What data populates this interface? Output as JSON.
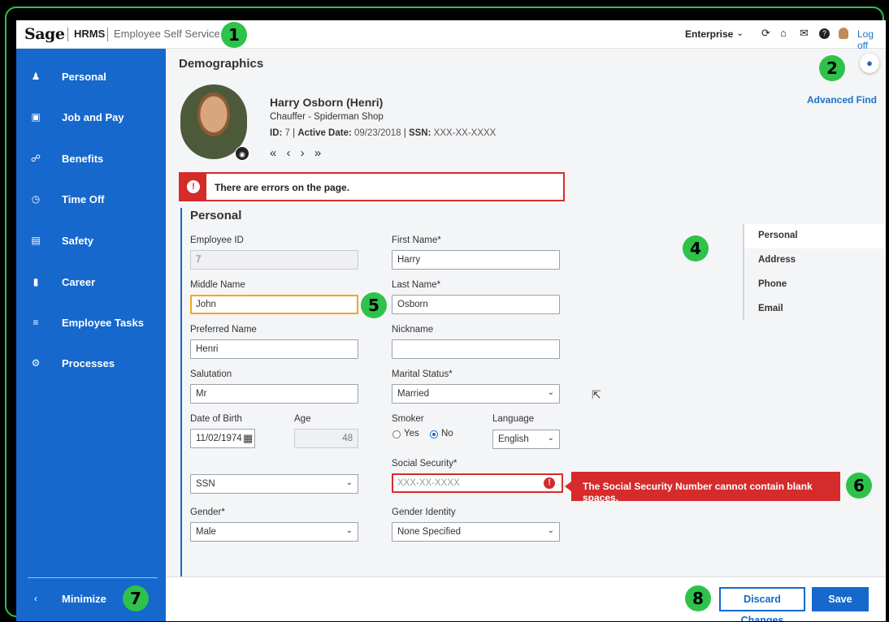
{
  "colors": {
    "primary": "#1668cc",
    "error": "#d52b2b",
    "callout": "#2ec24a",
    "focus": "#f0a81e"
  },
  "topbar": {
    "logo": "Sage",
    "app_name": "HRMS",
    "module": "Employee Self Service",
    "company": "Enterprise",
    "icons": [
      "chevron-down-icon",
      "refresh-icon",
      "home-icon",
      "mail-icon",
      "help-icon",
      "user-avatar-icon"
    ],
    "logoff": "Log off"
  },
  "sidebar": {
    "items": [
      {
        "label": "Personal",
        "icon": "person-icon"
      },
      {
        "label": "Job and Pay",
        "icon": "briefcase-icon"
      },
      {
        "label": "Benefits",
        "icon": "benefits-icon"
      },
      {
        "label": "Time Off",
        "icon": "clock-icon"
      },
      {
        "label": "Safety",
        "icon": "safety-icon"
      },
      {
        "label": "Career",
        "icon": "career-icon"
      },
      {
        "label": "Employee Tasks",
        "icon": "tasks-icon"
      },
      {
        "label": "Processes",
        "icon": "gear-icon"
      }
    ],
    "minimize": "Minimize"
  },
  "main": {
    "title": "Demographics",
    "advanced_find": "Advanced Find",
    "employee": {
      "name": "Harry Osborn (Henri)",
      "job": "Chauffer - Spiderman Shop",
      "id_label": "ID:",
      "id": "7",
      "active_label": "Active Date:",
      "active_date": "09/23/2018",
      "ssn_label": "SSN:",
      "ssn": "XXX-XX-XXXX",
      "pager": "« ‹ › »"
    },
    "error_message": "There are errors on the page.",
    "section_title": "Personal"
  },
  "form": {
    "employee_id": {
      "label": "Employee ID",
      "value": "7"
    },
    "first_name": {
      "label": "First Name*",
      "value": "Harry"
    },
    "middle_name": {
      "label": "Middle Name",
      "value": "John"
    },
    "last_name": {
      "label": "Last Name*",
      "value": "Osborn"
    },
    "preferred_name": {
      "label": "Preferred Name",
      "value": "Henri"
    },
    "nickname": {
      "label": "Nickname",
      "value": ""
    },
    "salutation": {
      "label": "Salutation",
      "value": "Mr"
    },
    "marital_status": {
      "label": "Marital Status*",
      "value": "Married"
    },
    "dob": {
      "label": "Date of Birth",
      "value": "11/02/1974"
    },
    "age": {
      "label": "Age",
      "value": "48"
    },
    "smoker": {
      "label": "Smoker",
      "yes": "Yes",
      "no": "No",
      "selected": "No"
    },
    "language": {
      "label": "Language",
      "value": "English"
    },
    "id_type": {
      "value": "SSN"
    },
    "social_security": {
      "label": "Social Security*",
      "placeholder": "XXX-XX-XXXX",
      "error": "The Social Security Number cannot contain blank spaces."
    },
    "gender": {
      "label": "Gender*",
      "value": "Male"
    },
    "gender_identity": {
      "label": "Gender Identity",
      "value": "None Specified"
    }
  },
  "subnav": {
    "items": [
      "Personal",
      "Address",
      "Phone",
      "Email"
    ],
    "active": "Personal"
  },
  "footer": {
    "discard": "Discard Changes",
    "save": "Save"
  },
  "callouts": [
    "1",
    "2",
    "4",
    "5",
    "6",
    "7",
    "8"
  ]
}
